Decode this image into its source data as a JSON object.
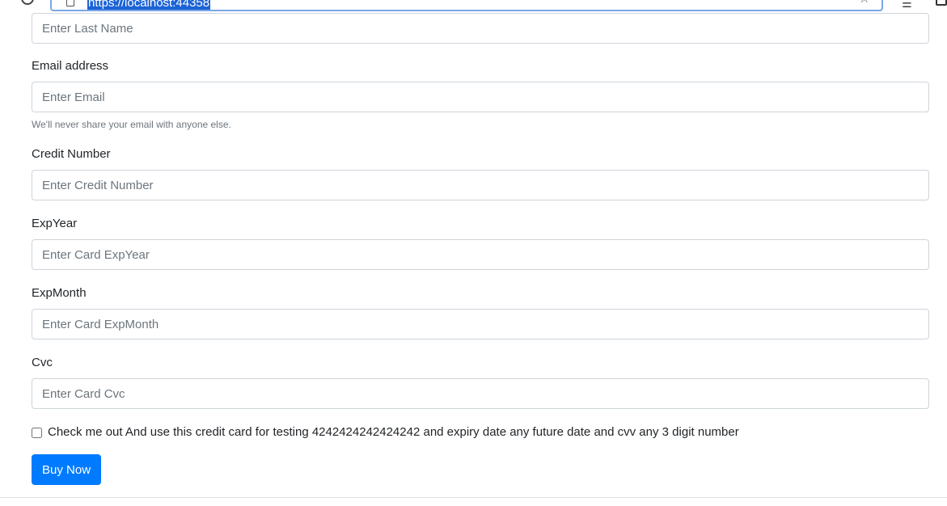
{
  "browser": {
    "url": "https://localhost:44358",
    "icons": [
      "reload-icon",
      "page-icon",
      "star-icon",
      "reading-list-icon",
      "collections-icon"
    ]
  },
  "form": {
    "last_name": {
      "placeholder": "Enter Last Name"
    },
    "email": {
      "label": "Email address",
      "placeholder": "Enter Email",
      "help": "We'll never share your email with anyone else."
    },
    "credit_number": {
      "label": "Credit Number",
      "placeholder": "Enter Credit Number"
    },
    "exp_year": {
      "label": "ExpYear",
      "placeholder": "Enter Card ExpYear"
    },
    "exp_month": {
      "label": "ExpMonth",
      "placeholder": "Enter Card ExpMonth"
    },
    "cvc": {
      "label": "Cvc",
      "placeholder": "Enter Card Cvc"
    },
    "checkbox": {
      "label": "Check me out And use this credit card for testing 4242424242424242 and expiry date any future date and cvv any 3 digit number",
      "checked": false
    },
    "submit_label": "Buy Now"
  },
  "colors": {
    "primary": "#007bff",
    "text": "#212529",
    "muted": "#6c757d",
    "border": "#ced4da",
    "url_highlight": "#1b63d6"
  }
}
